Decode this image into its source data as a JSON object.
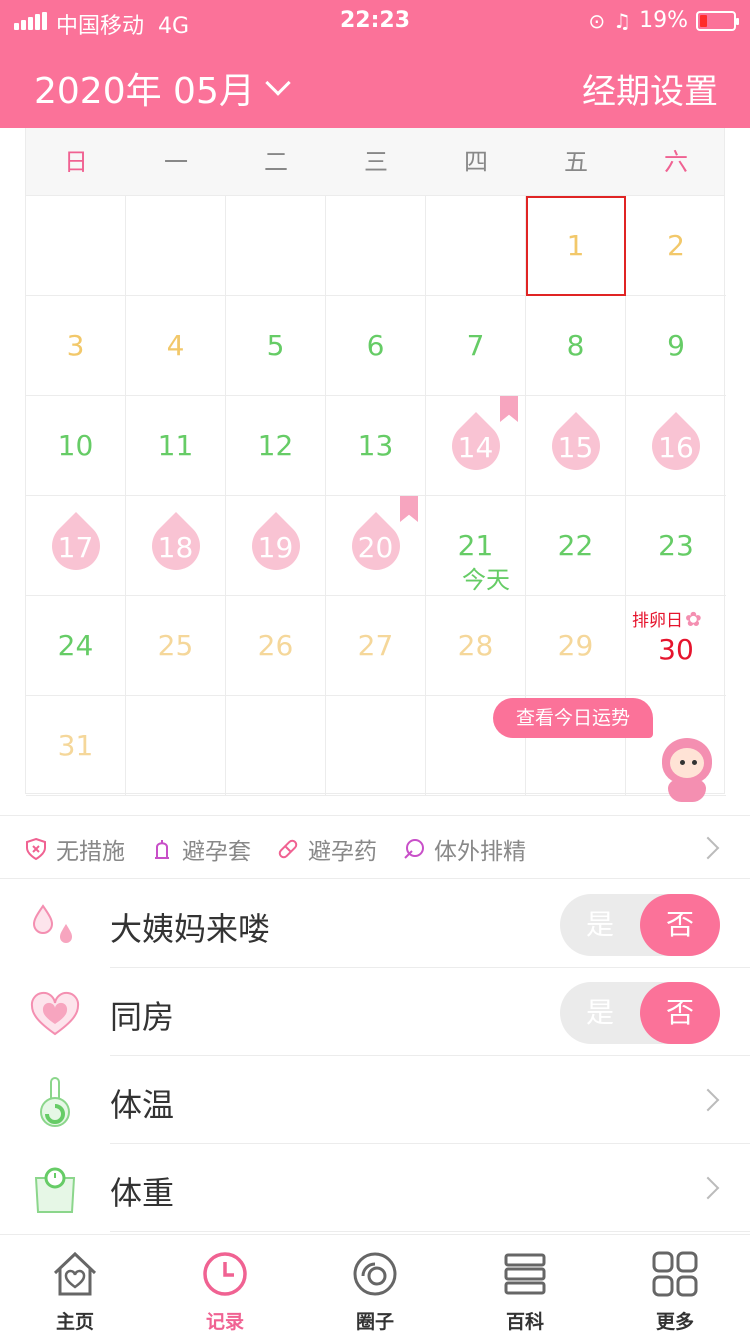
{
  "status_bar": {
    "carrier": "中国移动",
    "network": "4G",
    "time": "22:23",
    "battery": "19%"
  },
  "header": {
    "month": "2020年 05月",
    "settings": "经期设置"
  },
  "calendar": {
    "weekdays": [
      "日",
      "一",
      "二",
      "三",
      "四",
      "五",
      "六"
    ],
    "today_label": "今天",
    "ovulation_label": "排卵日",
    "fortune_button": "查看今日运势",
    "days": [
      {
        "n": "",
        "t": "empty"
      },
      {
        "n": "",
        "t": "empty"
      },
      {
        "n": "",
        "t": "empty"
      },
      {
        "n": "",
        "t": "empty"
      },
      {
        "n": "",
        "t": "empty"
      },
      {
        "n": "1",
        "t": "yellow",
        "selected": true
      },
      {
        "n": "2",
        "t": "yellow"
      },
      {
        "n": "3",
        "t": "yellow"
      },
      {
        "n": "4",
        "t": "yellow"
      },
      {
        "n": "5",
        "t": "green"
      },
      {
        "n": "6",
        "t": "green"
      },
      {
        "n": "7",
        "t": "green"
      },
      {
        "n": "8",
        "t": "green"
      },
      {
        "n": "9",
        "t": "green"
      },
      {
        "n": "10",
        "t": "green"
      },
      {
        "n": "11",
        "t": "green"
      },
      {
        "n": "12",
        "t": "green"
      },
      {
        "n": "13",
        "t": "green"
      },
      {
        "n": "14",
        "t": "period",
        "bookmark": true
      },
      {
        "n": "15",
        "t": "period"
      },
      {
        "n": "16",
        "t": "period"
      },
      {
        "n": "17",
        "t": "period"
      },
      {
        "n": "18",
        "t": "period"
      },
      {
        "n": "19",
        "t": "period"
      },
      {
        "n": "20",
        "t": "period",
        "bookmark": true
      },
      {
        "n": "21",
        "t": "green",
        "today": true
      },
      {
        "n": "22",
        "t": "green"
      },
      {
        "n": "23",
        "t": "green"
      },
      {
        "n": "24",
        "t": "green"
      },
      {
        "n": "25",
        "t": "fade"
      },
      {
        "n": "26",
        "t": "fade"
      },
      {
        "n": "27",
        "t": "fade"
      },
      {
        "n": "28",
        "t": "fade"
      },
      {
        "n": "29",
        "t": "fade"
      },
      {
        "n": "30",
        "t": "red",
        "ovulation": true
      },
      {
        "n": "31",
        "t": "fade"
      },
      {
        "n": "",
        "t": "empty"
      },
      {
        "n": "",
        "t": "empty"
      },
      {
        "n": "",
        "t": "empty"
      },
      {
        "n": "",
        "t": "empty"
      },
      {
        "n": "",
        "t": "empty"
      },
      {
        "n": "",
        "t": "empty"
      }
    ]
  },
  "contraception": [
    {
      "label": "无措施",
      "icon": "shield-x-icon"
    },
    {
      "label": "避孕套",
      "icon": "condom-icon"
    },
    {
      "label": "避孕药",
      "icon": "pill-icon"
    },
    {
      "label": "体外排精",
      "icon": "leaf-icon"
    }
  ],
  "records": {
    "period": {
      "label": "大姨妈来喽",
      "yes": "是",
      "no": "否",
      "icon": "droplets-icon"
    },
    "intimacy": {
      "label": "同房",
      "yes": "是",
      "no": "否",
      "icon": "heart-icon"
    },
    "temperature": {
      "label": "体温",
      "icon": "thermometer-icon"
    },
    "weight": {
      "label": "体重",
      "icon": "scale-icon"
    }
  },
  "tabs": [
    {
      "label": "主页",
      "icon": "home-icon"
    },
    {
      "label": "记录",
      "icon": "clock-icon",
      "active": true
    },
    {
      "label": "圈子",
      "icon": "circle-icon"
    },
    {
      "label": "百科",
      "icon": "books-icon"
    },
    {
      "label": "更多",
      "icon": "grid-icon"
    }
  ],
  "colors": {
    "brand": "#fb7299",
    "green": "#66cc66",
    "yellow": "#f2c86a",
    "ovulation": "#e6142d",
    "period_drop": "#f9c3d3"
  }
}
